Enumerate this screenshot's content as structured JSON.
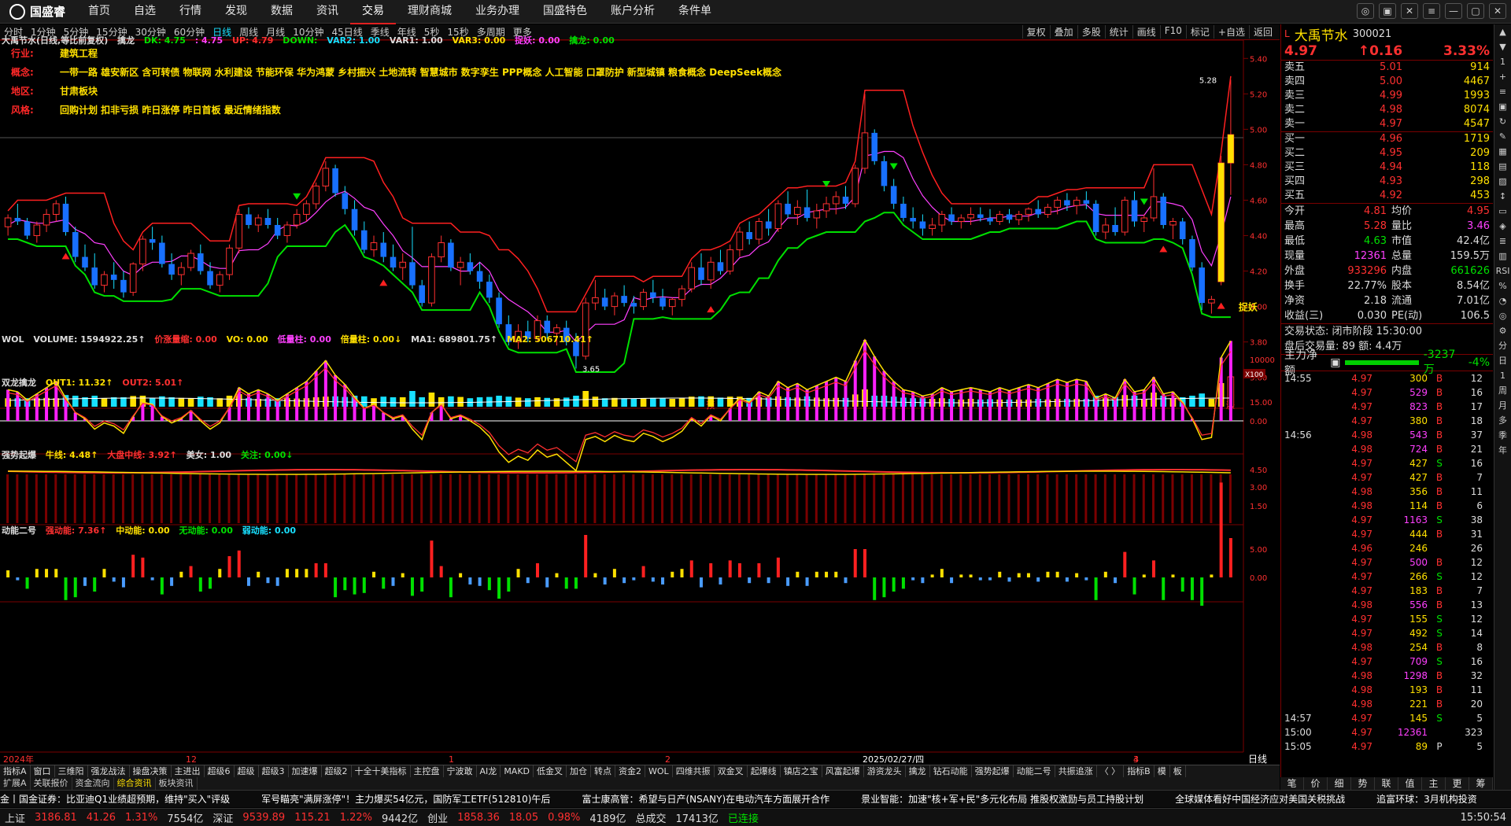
{
  "app": {
    "logo": "国盛睿"
  },
  "nav": [
    "首页",
    "自选",
    "行情",
    "发现",
    "数据",
    "资讯",
    "交易",
    "理财商城",
    "业务办理",
    "国盛特色",
    "账户分析",
    "条件单"
  ],
  "nav_active": 6,
  "periods": [
    "分时",
    "1分钟",
    "5分钟",
    "15分钟",
    "30分钟",
    "60分钟",
    "日线",
    "周线",
    "月线",
    "10分钟",
    "45日线",
    "季线",
    "年线",
    "5秒",
    "15秒",
    "多周期",
    "更多"
  ],
  "period_active": 6,
  "tools": [
    "复权",
    "叠加",
    "多股",
    "统计",
    "画线",
    "F10",
    "标记",
    "+自选",
    "返回"
  ],
  "main_legend": {
    "title": "大禹节水(日线,等比前复权)",
    "ind": "擒龙",
    "DK": "DK: 4.75",
    "c1": ": 4.75",
    "UP": "UP: 4.79",
    "DOWN": "DOWN: ",
    "VAR2": "VAR2: 1.00",
    "VAR1": "VAR1: 1.00",
    "VAR3": "VAR3: 0.00",
    "zy": "捉妖: 0.00",
    "ql": "擒龙: 0.00"
  },
  "info": [
    {
      "k": "行业:",
      "v": "建筑工程"
    },
    {
      "k": "概念:",
      "v": "一带一路 雄安新区 含可转债 物联网 水利建设 节能环保 华为鸿蒙 乡村振兴 土地流转 智慧城市 数字孪生 PPP概念 人工智能 口罩防护 新型城镇 粮食概念 DeepSeek概念"
    },
    {
      "k": "地区:",
      "v": "甘肃板块"
    },
    {
      "k": "风格:",
      "v": "回购计划 扣非亏损 昨日涨停 昨日首板 最近情绪指数"
    }
  ],
  "axis_main": [
    "5.40",
    "5.20",
    "5.00",
    "4.80",
    "4.60",
    "4.40",
    "4.20",
    "4.00",
    "3.80",
    "3.60"
  ],
  "annotations": {
    "high": "5.28",
    "low": "3.65",
    "zy_label": "捉妖",
    "ti": "预",
    "zhang": "涨"
  },
  "vol_legend": {
    "name": "WOL",
    "v1": "VOLUME: 1594922.25↑",
    "v2": "价涨量缩: 0.00",
    "v3": "VO: 0.00",
    "v4": "低量柱: 0.00",
    "v5": "倍量柱: 0.00↓",
    "v6": "MA1: 689801.75↑",
    "v7": "MA2: 506710.41↑"
  },
  "axis_vol": [
    "10000",
    "X100"
  ],
  "p2_legend": {
    "name": "双龙擒龙",
    "v1": "OUT1: 11.32↑",
    "v2": "OUT2: 5.01↑"
  },
  "axis_p2": [
    "15.00",
    "0.00"
  ],
  "p3_legend": {
    "name": "强势起爆",
    "v1": "牛线: 4.48↑",
    "v2": "大盘中线: 3.92↑",
    "v3": "美女: 1.00",
    "v4": "关注: 0.00↓"
  },
  "axis_p3": [
    "4.50",
    "3.00",
    "1.50"
  ],
  "p4_legend": {
    "name": "动能二号",
    "v1": "强动能: 7.36↑",
    "v2": "中动能: 0.00",
    "v3": "无动能: 0.00",
    "v4": "弱动能: 0.00"
  },
  "axis_p4": [
    "5.00",
    "0.00"
  ],
  "x_labels": [
    "2024年",
    "12",
    "1",
    "2",
    "2025/02/27/四",
    "3",
    "4"
  ],
  "x_label_right": "日线",
  "bottom_tabs": [
    "指标A",
    "窗口",
    "三维阳",
    "强龙战法",
    "操盘决策",
    "主进出",
    "超级6",
    "超级",
    "超级3",
    "加速爆",
    "超级2",
    "十全十美指标",
    "主控盘",
    "宁波敢",
    "AI龙",
    "MAKD",
    "低金叉",
    "加仓",
    "转点",
    "资金2",
    "WOL",
    "四维共振",
    "双金叉",
    "起爆线",
    "镇店之宝",
    "风富起爆",
    "游资龙头",
    "擒龙",
    "钻石动能",
    "强势起爆",
    "动能二号",
    "共振追涨",
    "〈 〉",
    "指标B",
    "模",
    "板"
  ],
  "bottom_tabs2": [
    "扩展A",
    "关联报价",
    "资金流向",
    "综合资讯",
    "板块资讯"
  ],
  "bottom_tabs2_active": 3,
  "ticker": [
    "金丨国金证券：比亚迪Q1业绩超预期，维持\"买入\"评级",
    "军号瞄亮\"满屏涨停\"！主力爆买54亿元，国防军工ETF(512810)午后",
    "富士康高管：希望与日产(NSANY)在电动汽车方面展开合作",
    "景业智能：加速\"核+军+民\"多元化布局 推股权激励与员工持股计划",
    "全球媒体看好中国经济应对美国关税挑战",
    "追富环球：3月机构投资"
  ],
  "status": [
    {
      "n": "上证",
      "p": "3186.81",
      "c": "41.26",
      "r": "1.31%",
      "a": "7554亿"
    },
    {
      "n": "深证",
      "p": "9539.89",
      "c": "115.21",
      "r": "1.22%",
      "a": "9442亿"
    },
    {
      "n": "创业",
      "p": "1858.36",
      "c": "18.05",
      "r": "0.98%",
      "a": "4189亿"
    }
  ],
  "status_total_label": "总成交",
  "status_total": "17413亿",
  "conn": "已连接",
  "clock": "15:50:54",
  "stock": {
    "name": "大禹节水",
    "code": "300021",
    "price": "4.97",
    "chg": "↑0.16",
    "pct": "3.33%"
  },
  "asks": [
    {
      "l": "卖五",
      "p": "5.01",
      "v": "914"
    },
    {
      "l": "卖四",
      "p": "5.00",
      "v": "4467"
    },
    {
      "l": "卖三",
      "p": "4.99",
      "v": "1993"
    },
    {
      "l": "卖二",
      "p": "4.98",
      "v": "8074"
    },
    {
      "l": "卖一",
      "p": "4.97",
      "v": "4547"
    }
  ],
  "bids": [
    {
      "l": "买一",
      "p": "4.96",
      "v": "1719"
    },
    {
      "l": "买二",
      "p": "4.95",
      "v": "209"
    },
    {
      "l": "买三",
      "p": "4.94",
      "v": "118"
    },
    {
      "l": "买四",
      "p": "4.93",
      "v": "298"
    },
    {
      "l": "买五",
      "p": "4.92",
      "v": "453"
    }
  ],
  "quote": [
    {
      "a": "今开",
      "b": "4.81",
      "bc": "red",
      "c": "均价",
      "d": "4.95",
      "dc": "red"
    },
    {
      "a": "最高",
      "b": "5.28",
      "bc": "red",
      "c": "量比",
      "d": "3.46",
      "dc": "mag"
    },
    {
      "a": "最低",
      "b": "4.63",
      "bc": "grn",
      "c": "市值",
      "d": "42.4亿",
      "dc": "wht"
    },
    {
      "a": "现量",
      "b": "12361",
      "bc": "mag",
      "c": "总量",
      "d": "159.5万",
      "dc": "wht"
    },
    {
      "a": "外盘",
      "b": "933296",
      "bc": "red",
      "c": "内盘",
      "d": "661626",
      "dc": "grn"
    },
    {
      "a": "换手",
      "b": "22.77%",
      "bc": "wht",
      "c": "股本",
      "d": "8.54亿",
      "dc": "wht"
    },
    {
      "a": "净资",
      "b": "2.18",
      "bc": "wht",
      "c": "流通",
      "d": "7.01亿",
      "dc": "wht"
    },
    {
      "a": "收益(三)",
      "b": "0.030",
      "bc": "wht",
      "c": "PE(动)",
      "d": "106.5",
      "dc": "wht"
    }
  ],
  "trade_state": "交易状态: 闭市阶段 15:30:00",
  "after_hours": "盘后交易量: 89  额: 4.4万",
  "zljl": {
    "label": "主力净额",
    "val": "-3237万",
    "pct": "-4%"
  },
  "ticks": [
    {
      "t": "14:55",
      "p": "4.97",
      "v": "300",
      "bs": "B",
      "n": "12",
      "vc": "yel"
    },
    {
      "t": "",
      "p": "4.97",
      "v": "529",
      "bs": "B",
      "n": "16",
      "vc": "mag"
    },
    {
      "t": "",
      "p": "4.97",
      "v": "823",
      "bs": "B",
      "n": "17",
      "vc": "mag"
    },
    {
      "t": "",
      "p": "4.97",
      "v": "380",
      "bs": "B",
      "n": "18",
      "vc": "yel"
    },
    {
      "t": "14:56",
      "p": "4.98",
      "v": "543",
      "bs": "B",
      "n": "37",
      "vc": "mag"
    },
    {
      "t": "",
      "p": "4.98",
      "v": "724",
      "bs": "B",
      "n": "21",
      "vc": "mag"
    },
    {
      "t": "",
      "p": "4.97",
      "v": "427",
      "bs": "S",
      "n": "16",
      "vc": "yel"
    },
    {
      "t": "",
      "p": "4.97",
      "v": "427",
      "bs": "B",
      "n": "7",
      "vc": "yel"
    },
    {
      "t": "",
      "p": "4.98",
      "v": "356",
      "bs": "B",
      "n": "11",
      "vc": "yel"
    },
    {
      "t": "",
      "p": "4.98",
      "v": "114",
      "bs": "B",
      "n": "6",
      "vc": "yel"
    },
    {
      "t": "",
      "p": "4.97",
      "v": "1163",
      "bs": "S",
      "n": "38",
      "vc": "mag"
    },
    {
      "t": "",
      "p": "4.97",
      "v": "444",
      "bs": "B",
      "n": "31",
      "vc": "yel"
    },
    {
      "t": "",
      "p": "4.96",
      "v": "246",
      "bs": "",
      "n": "26",
      "vc": "yel"
    },
    {
      "t": "",
      "p": "4.97",
      "v": "500",
      "bs": "B",
      "n": "12",
      "vc": "mag"
    },
    {
      "t": "",
      "p": "4.97",
      "v": "266",
      "bs": "S",
      "n": "12",
      "vc": "yel"
    },
    {
      "t": "",
      "p": "4.97",
      "v": "183",
      "bs": "B",
      "n": "7",
      "vc": "yel"
    },
    {
      "t": "",
      "p": "4.98",
      "v": "556",
      "bs": "B",
      "n": "13",
      "vc": "mag"
    },
    {
      "t": "",
      "p": "4.97",
      "v": "155",
      "bs": "S",
      "n": "12",
      "vc": "yel"
    },
    {
      "t": "",
      "p": "4.97",
      "v": "492",
      "bs": "S",
      "n": "14",
      "vc": "yel"
    },
    {
      "t": "",
      "p": "4.98",
      "v": "254",
      "bs": "B",
      "n": "8",
      "vc": "yel"
    },
    {
      "t": "",
      "p": "4.97",
      "v": "709",
      "bs": "S",
      "n": "16",
      "vc": "mag"
    },
    {
      "t": "",
      "p": "4.98",
      "v": "1298",
      "bs": "B",
      "n": "32",
      "vc": "mag"
    },
    {
      "t": "",
      "p": "4.98",
      "v": "193",
      "bs": "B",
      "n": "11",
      "vc": "yel"
    },
    {
      "t": "",
      "p": "4.98",
      "v": "221",
      "bs": "B",
      "n": "20",
      "vc": "yel"
    },
    {
      "t": "14:57",
      "p": "4.97",
      "v": "145",
      "bs": "S",
      "n": "5",
      "vc": "yel"
    },
    {
      "t": "15:00",
      "p": "4.97",
      "v": "12361",
      "bs": "",
      "n": "323",
      "vc": "mag"
    },
    {
      "t": "15:05",
      "p": "4.97",
      "v": "89",
      "bs": "P",
      "n": "5",
      "vc": "yel"
    }
  ],
  "rtabs": [
    "笔",
    "价",
    "细",
    "势",
    "联",
    "值",
    "主",
    "更",
    "筹"
  ],
  "sidebar": [
    "▲",
    "▼",
    "1",
    "+",
    "≡",
    "▣",
    "↻",
    "✎",
    "▦",
    "▤",
    "▨",
    "↕",
    "▭",
    "◈",
    "≣",
    "▥",
    "RSI",
    "%",
    "◔",
    "◎",
    "⚙",
    "分",
    "日",
    "1",
    "周",
    "月",
    "多",
    "季",
    "年"
  ],
  "colors": {
    "up": "#ff3030",
    "down": "#18e0ff",
    "bg": "#000000",
    "grid": "#7a0000",
    "accent": "#ffe000"
  },
  "chart_data": {
    "type": "candlestick",
    "title": "大禹节水(日线,等比前复权)",
    "ylim": [
      3.55,
      5.45
    ],
    "ohlc": [
      [
        4.45,
        4.52,
        4.4,
        4.5
      ],
      [
        4.5,
        4.58,
        4.46,
        4.48
      ],
      [
        4.48,
        4.5,
        4.38,
        4.4
      ],
      [
        4.4,
        4.48,
        4.36,
        4.46
      ],
      [
        4.46,
        4.55,
        4.42,
        4.52
      ],
      [
        4.52,
        4.6,
        4.48,
        4.58
      ],
      [
        4.58,
        4.62,
        4.4,
        4.42
      ],
      [
        4.42,
        4.45,
        4.25,
        4.28
      ],
      [
        4.28,
        4.35,
        4.2,
        4.22
      ],
      [
        4.22,
        4.3,
        4.1,
        4.12
      ],
      [
        4.12,
        4.2,
        4.08,
        4.18
      ],
      [
        4.18,
        4.25,
        4.1,
        4.15
      ],
      [
        4.15,
        4.2,
        4.05,
        4.08
      ],
      [
        4.08,
        4.25,
        4.06,
        4.24
      ],
      [
        4.24,
        4.4,
        4.2,
        4.38
      ],
      [
        4.38,
        4.45,
        4.32,
        4.36
      ],
      [
        4.36,
        4.4,
        4.22,
        4.24
      ],
      [
        4.24,
        4.3,
        4.15,
        4.18
      ],
      [
        4.18,
        4.25,
        4.12,
        4.22
      ],
      [
        4.22,
        4.32,
        4.2,
        4.3
      ],
      [
        4.3,
        4.35,
        4.18,
        4.2
      ],
      [
        4.2,
        4.25,
        4.1,
        4.12
      ],
      [
        4.12,
        4.2,
        4.08,
        4.18
      ],
      [
        4.18,
        4.35,
        4.15,
        4.33
      ],
      [
        4.33,
        4.55,
        4.3,
        4.52
      ],
      [
        4.52,
        4.56,
        4.44,
        4.46
      ],
      [
        4.46,
        4.52,
        4.42,
        4.5
      ],
      [
        4.5,
        4.55,
        4.44,
        4.46
      ],
      [
        4.46,
        4.5,
        4.38,
        4.4
      ],
      [
        4.4,
        4.48,
        4.36,
        4.46
      ],
      [
        4.46,
        4.55,
        4.44,
        4.52
      ],
      [
        4.52,
        4.6,
        4.48,
        4.58
      ],
      [
        4.58,
        4.7,
        4.55,
        4.68
      ],
      [
        4.68,
        4.82,
        4.65,
        4.78
      ],
      [
        4.78,
        4.8,
        4.62,
        4.64
      ],
      [
        4.64,
        4.68,
        4.52,
        4.55
      ],
      [
        4.55,
        4.6,
        4.4,
        4.43
      ],
      [
        4.43,
        4.48,
        4.3,
        4.32
      ],
      [
        4.32,
        4.4,
        4.28,
        4.36
      ],
      [
        4.36,
        4.42,
        4.25,
        4.28
      ],
      [
        4.28,
        4.35,
        4.2,
        4.22
      ],
      [
        4.22,
        4.3,
        4.15,
        4.25
      ],
      [
        4.25,
        4.45,
        4.1,
        4.12
      ],
      [
        4.12,
        4.15,
        4.0,
        4.02
      ],
      [
        4.02,
        4.3,
        4.0,
        4.28
      ],
      [
        4.28,
        4.4,
        4.25,
        4.36
      ],
      [
        4.36,
        4.38,
        4.2,
        4.22
      ],
      [
        4.22,
        4.28,
        4.12,
        4.25
      ],
      [
        4.25,
        4.3,
        4.18,
        4.2
      ],
      [
        4.2,
        4.25,
        4.1,
        4.14
      ],
      [
        4.14,
        4.18,
        4.02,
        4.05
      ],
      [
        4.05,
        4.08,
        3.88,
        3.9
      ],
      [
        3.9,
        3.95,
        3.78,
        3.8
      ],
      [
        3.8,
        3.9,
        3.76,
        3.86
      ],
      [
        3.86,
        3.92,
        3.8,
        3.82
      ],
      [
        3.82,
        3.95,
        3.8,
        3.92
      ],
      [
        3.92,
        3.95,
        3.82,
        3.85
      ],
      [
        3.85,
        3.9,
        3.78,
        3.88
      ],
      [
        3.88,
        3.92,
        3.78,
        3.8
      ],
      [
        3.8,
        3.85,
        3.65,
        3.72
      ],
      [
        3.72,
        4.05,
        3.7,
        4.02
      ],
      [
        4.02,
        4.15,
        3.98,
        4.05
      ],
      [
        4.05,
        4.1,
        3.98,
        4.0
      ],
      [
        4.0,
        4.08,
        3.95,
        4.06
      ],
      [
        4.06,
        4.12,
        4.0,
        4.02
      ],
      [
        4.02,
        4.06,
        3.96,
        4.0
      ],
      [
        4.0,
        4.1,
        3.98,
        4.08
      ],
      [
        4.08,
        4.15,
        4.02,
        4.05
      ],
      [
        4.05,
        4.1,
        3.98,
        4.0
      ],
      [
        4.0,
        4.05,
        3.95,
        4.04
      ],
      [
        4.04,
        4.12,
        4.0,
        4.1
      ],
      [
        4.1,
        4.25,
        4.08,
        4.22
      ],
      [
        4.22,
        4.3,
        4.12,
        4.15
      ],
      [
        4.15,
        4.28,
        4.1,
        4.25
      ],
      [
        4.25,
        4.32,
        4.18,
        4.2
      ],
      [
        4.2,
        4.35,
        4.18,
        4.32
      ],
      [
        4.32,
        4.45,
        4.28,
        4.42
      ],
      [
        4.42,
        4.48,
        4.35,
        4.38
      ],
      [
        4.38,
        4.5,
        4.35,
        4.48
      ],
      [
        4.48,
        4.55,
        4.4,
        4.44
      ],
      [
        4.44,
        4.6,
        4.42,
        4.58
      ],
      [
        4.58,
        4.65,
        4.5,
        4.52
      ],
      [
        4.52,
        4.6,
        4.46,
        4.56
      ],
      [
        4.56,
        4.66,
        4.48,
        4.5
      ],
      [
        4.5,
        4.58,
        4.44,
        4.54
      ],
      [
        4.54,
        4.62,
        4.5,
        4.58
      ],
      [
        4.58,
        4.65,
        4.52,
        4.62
      ],
      [
        4.62,
        4.68,
        4.55,
        4.58
      ],
      [
        4.58,
        4.8,
        4.56,
        4.78
      ],
      [
        4.78,
        5.2,
        4.75,
        4.98
      ],
      [
        4.98,
        5.0,
        4.8,
        4.82
      ],
      [
        4.82,
        4.85,
        4.65,
        4.68
      ],
      [
        4.68,
        4.72,
        4.55,
        4.58
      ],
      [
        4.58,
        4.62,
        4.48,
        4.5
      ],
      [
        4.5,
        4.56,
        4.44,
        4.48
      ],
      [
        4.48,
        4.52,
        4.4,
        4.44
      ],
      [
        4.44,
        4.5,
        4.4,
        4.46
      ],
      [
        4.46,
        4.54,
        4.42,
        4.52
      ],
      [
        4.52,
        4.56,
        4.46,
        4.48
      ],
      [
        4.48,
        4.52,
        4.44,
        4.5
      ],
      [
        4.5,
        4.56,
        4.46,
        4.52
      ],
      [
        4.52,
        4.56,
        4.48,
        4.5
      ],
      [
        4.5,
        4.55,
        4.46,
        4.48
      ],
      [
        4.48,
        4.54,
        4.46,
        4.52
      ],
      [
        4.52,
        4.55,
        4.47,
        4.49
      ],
      [
        4.49,
        4.54,
        4.46,
        4.52
      ],
      [
        4.52,
        4.56,
        4.48,
        4.55
      ],
      [
        4.55,
        4.6,
        4.5,
        4.52
      ],
      [
        4.52,
        4.58,
        4.5,
        4.56
      ],
      [
        4.56,
        4.62,
        4.52,
        4.6
      ],
      [
        4.6,
        4.64,
        4.54,
        4.57
      ],
      [
        4.57,
        4.62,
        4.52,
        4.6
      ],
      [
        4.6,
        4.65,
        4.55,
        4.58
      ],
      [
        4.58,
        4.6,
        4.4,
        4.42
      ],
      [
        4.42,
        4.5,
        4.38,
        4.46
      ],
      [
        4.46,
        4.56,
        4.4,
        4.42
      ],
      [
        4.42,
        4.62,
        4.4,
        4.6
      ],
      [
        4.6,
        4.65,
        4.45,
        4.48
      ],
      [
        4.48,
        4.52,
        4.42,
        4.5
      ],
      [
        4.5,
        4.78,
        4.48,
        4.62
      ],
      [
        4.62,
        4.64,
        4.44,
        4.46
      ],
      [
        4.46,
        4.5,
        4.38,
        4.48
      ],
      [
        4.48,
        4.5,
        4.35,
        4.38
      ],
      [
        4.38,
        4.4,
        4.2,
        4.22
      ],
      [
        4.22,
        4.25,
        3.98,
        4.02
      ],
      [
        4.02,
        4.06,
        3.96,
        4.04
      ],
      [
        4.14,
        4.85,
        4.12,
        4.81
      ],
      [
        4.81,
        5.28,
        4.63,
        4.97
      ]
    ]
  }
}
